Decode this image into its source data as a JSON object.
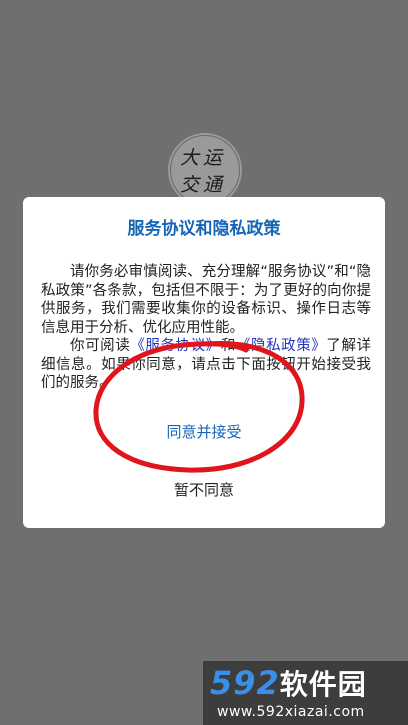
{
  "splash": {
    "logo_text": "大运交通"
  },
  "dialog": {
    "title": "服务协议和隐私政策",
    "paragraph1": "请你务必审慎阅读、充分理解“服务协议”和“隐私政策”各条款，包括但不限于：为了更好的向你提供服务，我们需要收集你的设备标识、操作日志等信息用于分析、优化应用性能。",
    "paragraph2_prefix": "你可阅读",
    "service_link": "《服务协议》",
    "paragraph2_and": "和",
    "privacy_link": "《隐私政策》",
    "paragraph2_suffix": "了解详细信息。如果你同意，请点击下面按钮开始接受我们的服务。",
    "accept_label": "同意并接受",
    "decline_label": "暂不同意"
  },
  "annotation": {
    "color": "#e0141c"
  },
  "watermark": {
    "logo_number": "592",
    "logo_text": "软件园",
    "url": "www.592xiazai.com"
  }
}
